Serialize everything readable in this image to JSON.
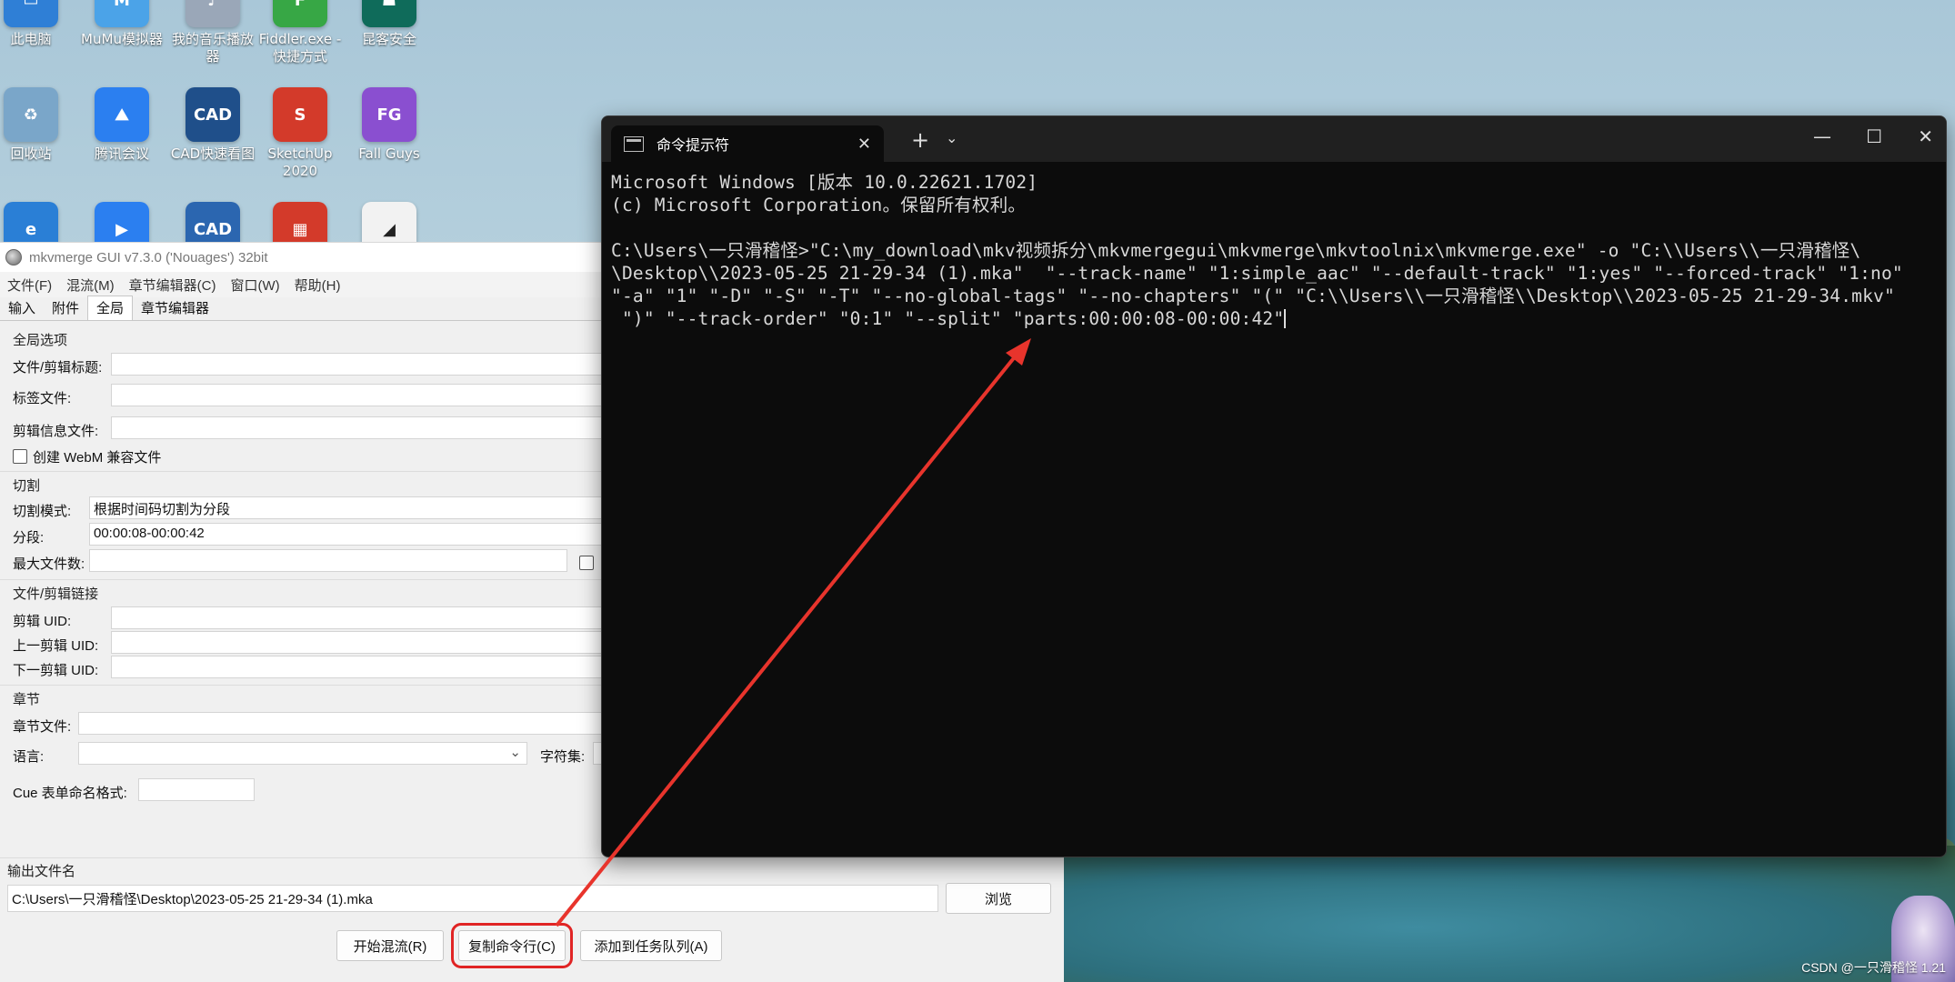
{
  "desktop": {
    "icons": [
      {
        "label": "此电脑",
        "color": "#2f7fd6",
        "glyph": "▭"
      },
      {
        "label": "MuMu模拟器",
        "color": "#4ba3e8",
        "glyph": "M"
      },
      {
        "label": "我的音乐播放器",
        "color": "#9aa7b8",
        "glyph": "♪"
      },
      {
        "label": "Fiddler.exe - 快捷方式",
        "color": "#37a745",
        "glyph": "F"
      },
      {
        "label": "昆客安全",
        "color": "#0f6b5a",
        "glyph": "☗"
      },
      {
        "label": "回收站",
        "color": "#7aa6c9",
        "glyph": "♻"
      },
      {
        "label": "腾讯会议",
        "color": "#2b7ff0",
        "glyph": "⛰"
      },
      {
        "label": "CAD快速看图",
        "color": "#1f4f8a",
        "glyph": "CAD"
      },
      {
        "label": "SketchUp 2020",
        "color": "#d33a2a",
        "glyph": "S"
      },
      {
        "label": "Fall Guys",
        "color": "#8a4fd0",
        "glyph": "FG"
      },
      {
        "label": "",
        "color": "#2a7fd6",
        "glyph": "e"
      },
      {
        "label": "",
        "color": "#2b7ff0",
        "glyph": "▶"
      },
      {
        "label": "",
        "color": "#2b66b0",
        "glyph": "CAD"
      },
      {
        "label": "",
        "color": "#d33a2a",
        "glyph": "▦"
      },
      {
        "label": "",
        "color": "#f2f2f2",
        "glyph": "◢"
      }
    ]
  },
  "mkv": {
    "title": "mkvmerge GUI v7.3.0 ('Nouages') 32bit",
    "menu": [
      "文件(F)",
      "混流(M)",
      "章节编辑器(C)",
      "窗口(W)",
      "帮助(H)"
    ],
    "tabs": [
      "输入",
      "附件",
      "全局",
      "章节编辑器"
    ],
    "global_group": "全局选项",
    "file_title_label": "文件/剪辑标题:",
    "tags_label": "标签文件:",
    "seg_info_label": "剪辑信息文件:",
    "webm_label": "创建 WebM 兼容文件",
    "split_group": "切割",
    "split_mode_label": "切割模式:",
    "split_mode_value": "根据时间码切割为分段",
    "segments_label": "分段:",
    "segments_value": "00:00:08-00:00:42",
    "max_files_label": "最大文件数:",
    "link_group": "文件/剪辑链接",
    "seg_uid_label": "剪辑 UID:",
    "prev_uid_label": "上一剪辑 UID:",
    "next_uid_label": "下一剪辑 UID:",
    "chapters_group": "章节",
    "chapter_file_label": "章节文件:",
    "language_label": "语言:",
    "charset_label": "字符集:",
    "cue_label": "Cue 表单命名格式:",
    "output_group": "输出文件名",
    "output_value": "C:\\Users\\一只滑稽怪\\Desktop\\2023-05-25 21-29-34 (1).mka",
    "browse_label": "浏览",
    "start_label": "开始混流(R)",
    "copy_cmd_label": "复制命令行(C)",
    "add_queue_label": "添加到任务队列(A)"
  },
  "cmd": {
    "tab_title": "命令提示符",
    "lines": [
      "Microsoft Windows [版本 10.0.22621.1702]",
      "(c) Microsoft Corporation。保留所有权利。",
      "",
      "C:\\Users\\一只滑稽怪>\"C:\\my_download\\mkv视频拆分\\mkvmergegui\\mkvmerge\\mkvtoolnix\\mkvmerge.exe\" -o \"C:\\\\Users\\\\一只滑稽怪\\",
      "\\Desktop\\\\2023-05-25 21-29-34 (1).mka\"  \"--track-name\" \"1:simple_aac\" \"--default-track\" \"1:yes\" \"--forced-track\" \"1:no\"",
      "\"-a\" \"1\" \"-D\" \"-S\" \"-T\" \"--no-global-tags\" \"--no-chapters\" \"(\" \"C:\\\\Users\\\\一只滑稽怪\\\\Desktop\\\\2023-05-25 21-29-34.mkv\"",
      " \")\" \"--track-order\" \"0:1\" \"--split\" \"parts:00:00:08-00:00:42\""
    ]
  },
  "annotation": {
    "arrow_color": "#e8342c"
  },
  "watermark": "CSDN @一只滑稽怪 1.21"
}
